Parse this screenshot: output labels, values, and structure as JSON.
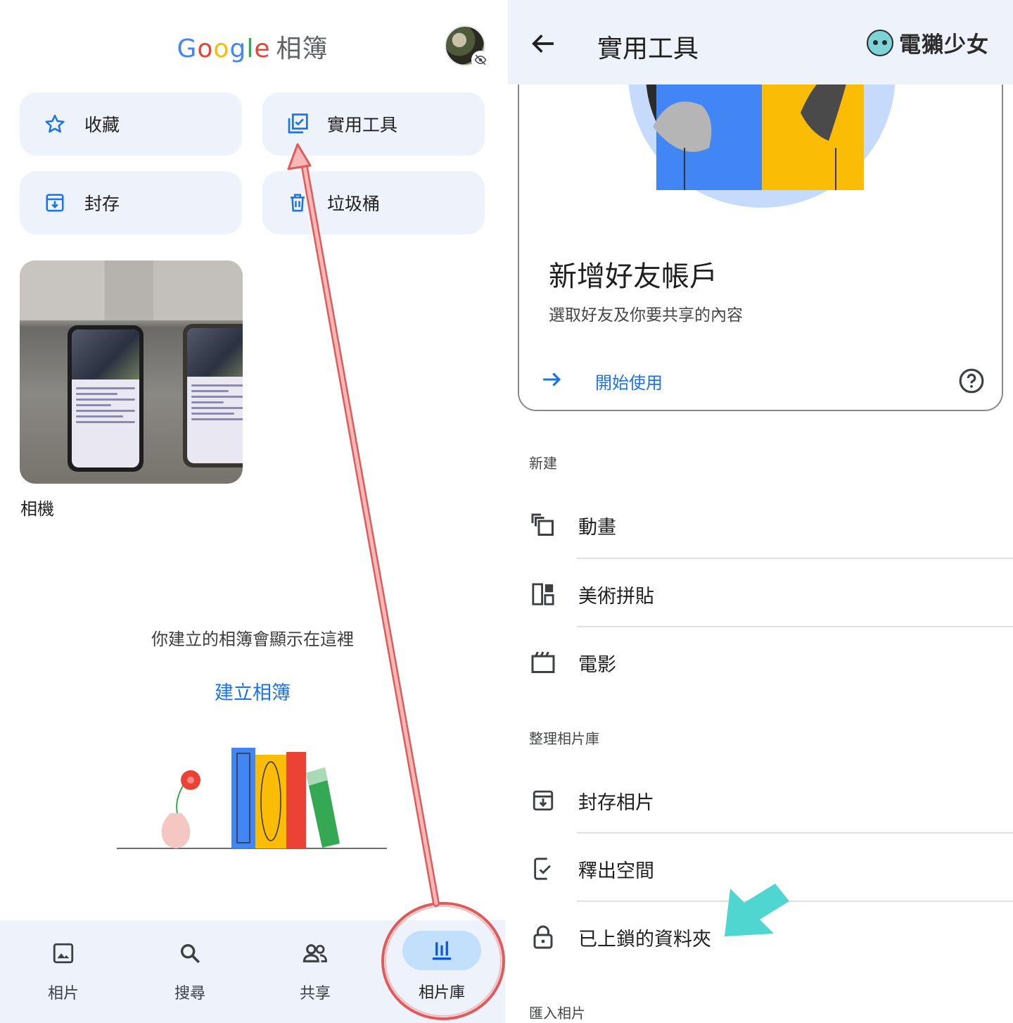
{
  "left": {
    "brand": {
      "g": "G",
      "o1": "o",
      "o2": "o",
      "g2": "g",
      "l": "l",
      "e": "e",
      "suffix": "相簿"
    },
    "tiles": [
      {
        "label": "收藏",
        "icon": "star-icon"
      },
      {
        "label": "實用工具",
        "icon": "utilities-icon"
      },
      {
        "label": "封存",
        "icon": "archive-icon"
      },
      {
        "label": "垃圾桶",
        "icon": "trash-icon"
      }
    ],
    "album": {
      "label": "相機"
    },
    "empty_text": "你建立的相簿會顯示在這裡",
    "create_link": "建立相簿",
    "nav": [
      {
        "label": "相片",
        "icon": "photo-icon"
      },
      {
        "label": "搜尋",
        "icon": "search-icon"
      },
      {
        "label": "共享",
        "icon": "people-icon"
      },
      {
        "label": "相片庫",
        "icon": "library-icon",
        "active": true
      }
    ]
  },
  "right": {
    "title": "實用工具",
    "logo_text": "電獺少女",
    "card": {
      "title": "新增好友帳戶",
      "subtitle": "選取好友及你要共享的內容",
      "cta": "開始使用"
    },
    "sections": {
      "new": "新建",
      "organize": "整理相片庫",
      "import": "匯入相片"
    },
    "new_items": [
      {
        "label": "動畫",
        "icon": "animation-icon"
      },
      {
        "label": "美術拼貼",
        "icon": "collage-icon"
      },
      {
        "label": "電影",
        "icon": "movie-icon"
      }
    ],
    "organize_items": [
      {
        "label": "封存相片",
        "icon": "archive-icon"
      },
      {
        "label": "釋出空間",
        "icon": "free-up-space-icon"
      },
      {
        "label": "已上鎖的資料夾",
        "icon": "lock-icon"
      }
    ]
  },
  "colors": {
    "accent_blue": "#1a73e8",
    "tile_bg": "#eef2fb",
    "annotation_red": "#e05a5a",
    "annotation_cyan": "#4fd6d0"
  }
}
